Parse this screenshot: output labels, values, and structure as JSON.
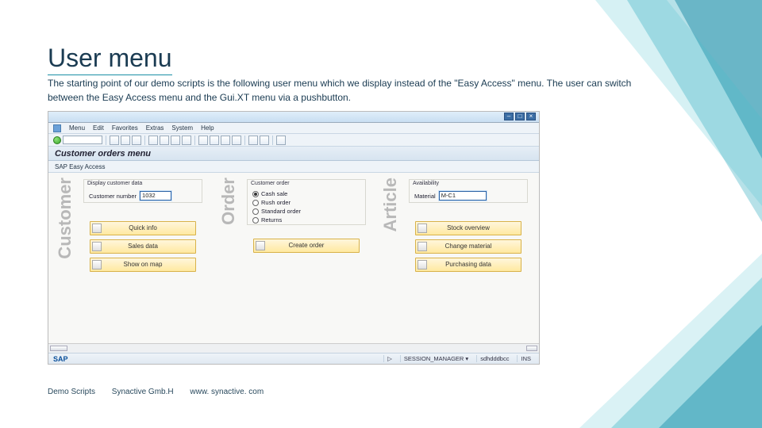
{
  "slide": {
    "title": "User menu",
    "desc": "The starting point of our demo scripts is the following user menu which we display instead of the \"Easy Access\" menu. The user can switch between the Easy Access menu and the Gui.XT menu via a pushbutton.",
    "footer": [
      "Demo Scripts",
      "Synactive Gmb.H",
      "www. synactive. com"
    ]
  },
  "sap": {
    "menubar": [
      "Menu",
      "Edit",
      "Favorites",
      "Extras",
      "System",
      "Help"
    ],
    "title": "Customer orders menu",
    "tool2": "SAP Easy Access",
    "customer": {
      "label": "Customer",
      "panel_head": "Display customer data",
      "number_label": "Customer number",
      "number_value": "1032",
      "buttons": [
        "Quick info",
        "Sales data",
        "Show on map"
      ]
    },
    "order": {
      "label": "Order",
      "panel_head": "Customer order",
      "options": [
        "Cash sale",
        "Rush order",
        "Standard order",
        "Returns"
      ],
      "selected": 0,
      "buttons": [
        "Create order"
      ]
    },
    "article": {
      "label": "Article",
      "panel_head": "Availability",
      "material_label": "Material",
      "material_value": "M-C1",
      "buttons": [
        "Stock overview",
        "Change material",
        "Purchasing data"
      ]
    },
    "status": {
      "logo": "SAP",
      "items": [
        "▷",
        "SESSION_MANAGER ▾",
        "sdhdddbcc",
        "INS"
      ]
    }
  }
}
